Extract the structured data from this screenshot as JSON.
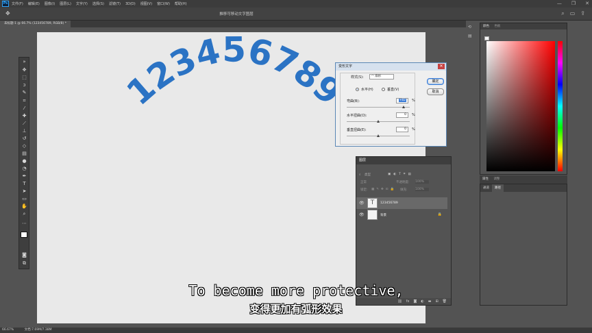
{
  "app": {
    "logo": "Ps",
    "menu": [
      "文件(F)",
      "编辑(E)",
      "图像(I)",
      "图层(L)",
      "文字(Y)",
      "选择(S)",
      "滤镜(T)",
      "3D(D)",
      "视图(V)",
      "窗口(W)",
      "帮助(H)"
    ],
    "window_controls": [
      "—",
      "❐",
      "✕"
    ],
    "options_title": "推移可移动文字图层",
    "doc_tab": "未标题-1 @ 66.7% (123456789, RGB/8) *"
  },
  "canvas": {
    "warped_text": "123456789",
    "text_color": "#2b73c4"
  },
  "warp_dialog": {
    "title": "变形文字",
    "close": "✕",
    "style_label": "样式(S):",
    "style_value": "扇形",
    "horizontal_label": "水平(H)",
    "vertical_label": "垂直(V)",
    "orientation_selected": "horizontal",
    "bend_label": "弯曲(B):",
    "bend_value": "+82",
    "hdist_label": "水平扭曲(O):",
    "hdist_value": "0",
    "vdist_label": "垂直扭曲(E):",
    "vdist_value": "0",
    "percent": "%",
    "ok": "确定",
    "cancel": "取消"
  },
  "layers_panel": {
    "title": "图层",
    "kind_label": "类型",
    "blend": "正常",
    "opacity_label": "不透明度:",
    "opacity_value": "100%",
    "lock_label": "锁定:",
    "fill_label": "填充:",
    "fill_value": "100%",
    "layers": [
      {
        "name": "123456789",
        "type": "text"
      },
      {
        "name": "背景",
        "type": "background"
      }
    ]
  },
  "right_panels": {
    "color_tab": "颜色",
    "swatches_tab": "色板",
    "properties_tab": "属性",
    "adjustments_tab": "调整",
    "channels_tab": "通道",
    "paths_tab": "路径"
  },
  "status": {
    "zoom": "66.67%",
    "doc": "文档:7.69M/7.38M"
  },
  "subtitles": {
    "en": "To become more protective,",
    "cn": "变得更加有弧形效果"
  }
}
